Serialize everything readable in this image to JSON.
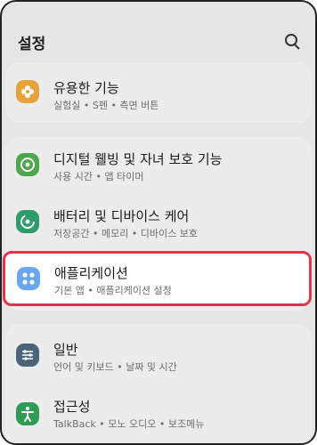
{
  "header": {
    "title": "설정",
    "search_icon": "search-icon"
  },
  "items": [
    {
      "id": "advanced",
      "title": "유용한 기능",
      "subtitle": "실험실 • S펜 • 측면 버튼",
      "icon": "gear-flower-icon",
      "color": "#e6a23b"
    },
    {
      "id": "digital-wellbeing",
      "title": "디지털 웰빙 및 자녀 보호 기능",
      "subtitle": "사용 시간 • 앱 타이머",
      "icon": "wellbeing-icon",
      "color": "#4ca64c"
    },
    {
      "id": "battery",
      "title": "배터리 및 디바이스 케어",
      "subtitle": "저장공간 • 메모리 • 디바이스 보호",
      "icon": "device-care-icon",
      "color": "#2f9c6b"
    },
    {
      "id": "apps",
      "title": "애플리케이션",
      "subtitle": "기본 앱 • 애플리케이션 설정",
      "icon": "apps-icon",
      "color": "#6aa7f0"
    },
    {
      "id": "general",
      "title": "일반",
      "subtitle": "언어 및 키보드 • 날짜 및 시간",
      "icon": "sliders-icon",
      "color": "#4a6479"
    },
    {
      "id": "accessibility",
      "title": "접근성",
      "subtitle": "TalkBack • 모노 오디오 • 보조메뉴",
      "icon": "accessibility-icon",
      "color": "#2f9c55"
    }
  ]
}
